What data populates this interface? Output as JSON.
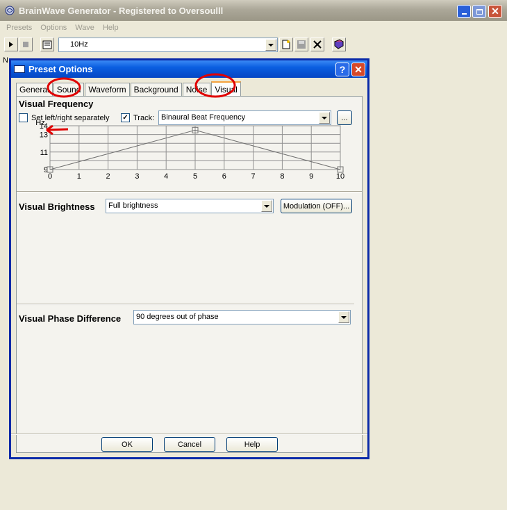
{
  "app": {
    "title": "BrainWave Generator - Registered to Oversoulll",
    "menus": [
      "Presets",
      "Options",
      "Wave",
      "Help"
    ],
    "preset_value": "10Hz",
    "stray_char": "N",
    "win_buttons": {
      "minimize": "_",
      "maximize": "□",
      "close": "✕"
    }
  },
  "dialog": {
    "title": "Preset Options",
    "help_glyph": "?",
    "close_glyph": "✕",
    "tabs": [
      "General",
      "Sound",
      "Waveform",
      "Background",
      "Noise",
      "Visual"
    ],
    "active_tab": "Visual",
    "visual_frequency": {
      "heading": "Visual Frequency",
      "set_separately_label": "Set left/right separately",
      "set_separately_checked": false,
      "track_label": "Track:",
      "track_checked": true,
      "track_value": "Binaural Beat Frequency",
      "ellipsis_label": "...",
      "hz_label": "Hz"
    },
    "visual_brightness": {
      "heading": "Visual Brightness",
      "value": "Full brightness",
      "modulation_label": "Modulation (OFF)..."
    },
    "visual_phase": {
      "heading": "Visual Phase Difference",
      "value": "90 degrees out of phase"
    },
    "buttons": {
      "ok": "OK",
      "cancel": "Cancel",
      "help": "Help"
    }
  },
  "chart_data": {
    "type": "line",
    "ylabel": "Hz",
    "x_ticks": [
      "0",
      "1",
      "2",
      "3",
      "4",
      "5",
      "6",
      "7",
      "8",
      "9",
      "10"
    ],
    "y_ticks": [
      "9",
      "11",
      "13",
      "14"
    ],
    "xlim": [
      0,
      10
    ],
    "ylim": [
      9,
      14
    ],
    "grid": true,
    "points": [
      {
        "x": 0,
        "y": 9
      },
      {
        "x": 5,
        "y": 13.5
      },
      {
        "x": 10,
        "y": 9
      }
    ]
  },
  "colors": {
    "annotation": "#e00000",
    "xp_blue": "#0a5ee0",
    "face": "#ece9d8"
  }
}
